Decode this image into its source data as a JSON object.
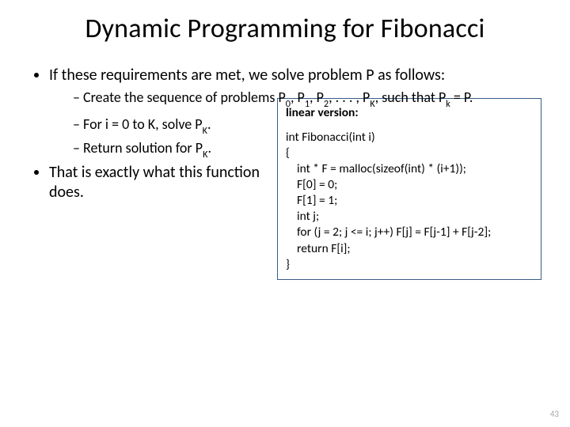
{
  "title": "Dynamic Programming for Fibonacci",
  "bullets": {
    "b1": "If these requirements are met, we solve problem P as follows:",
    "b1_sub1_pre": "Create the sequence of problems P",
    "b1_sub1_mid1": ", P",
    "b1_sub1_mid2": ", P",
    "b1_sub1_mid3": ", . . . , P",
    "b1_sub1_mid4": ", such that P",
    "b1_sub1_end": " = P.",
    "b1_sub2_pre": "For i = 0 to K, solve P",
    "b1_sub2_end": ".",
    "b1_sub3_pre": "Return solution for P",
    "b1_sub3_end": ".",
    "b2": "That is exactly what this function does."
  },
  "subs": {
    "s0": "0",
    "s1": "1",
    "s2": "2",
    "sK": "K",
    "sk": "k"
  },
  "code": {
    "label": "linear version:",
    "line1": "int Fibonacci(int i)",
    "line2": "{",
    "line3": "    int * F = malloc(sizeof(int) * (i+1));",
    "line4": "    F[0] = 0;",
    "line5": "    F[1] = 1;",
    "line6": "    int j;",
    "line7": "    for (j = 2; j <= i; j++) F[j] = F[j-1] + F[j-2];",
    "line8": "    return F[i];",
    "line9": "}"
  },
  "pagenum": "43"
}
